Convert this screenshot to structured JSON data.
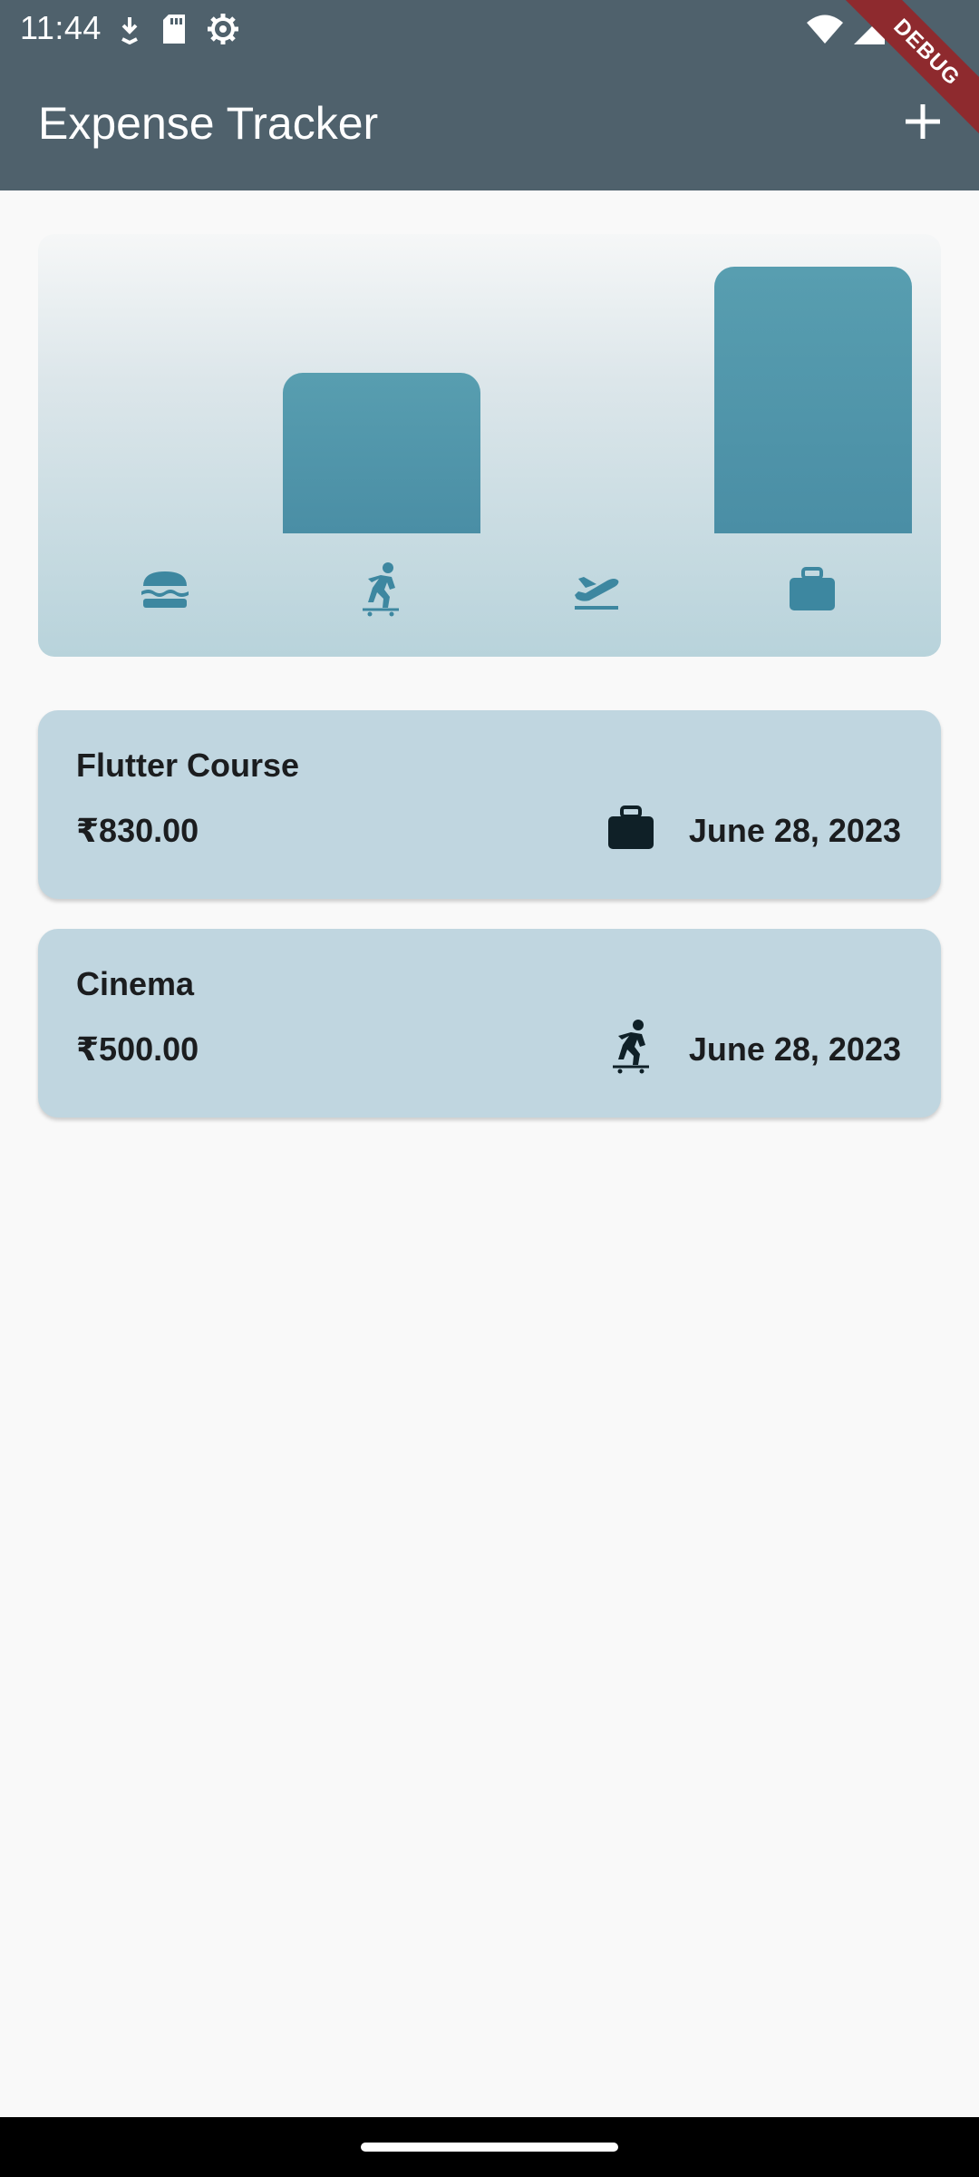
{
  "status_bar": {
    "time": "11:44",
    "left_icons": [
      "download-icon",
      "sd-card-icon",
      "settings-gear-icon"
    ],
    "right_icons": [
      "wifi-icon",
      "signal-icon",
      "battery-icon"
    ]
  },
  "app_bar": {
    "title": "Expense Tracker",
    "add_icon": "plus-icon",
    "debug_label": "DEBUG"
  },
  "chart_data": {
    "type": "bar",
    "categories": [
      "food",
      "leisure",
      "travel",
      "work"
    ],
    "category_icons": [
      "burger-icon",
      "skateboarding-icon",
      "flight-takeoff-icon",
      "work-briefcase-icon"
    ],
    "values": [
      0,
      500,
      0,
      830
    ],
    "ylim": [
      0,
      830
    ],
    "bar_color": "#4A8EA5"
  },
  "expenses": [
    {
      "title": "Flutter Course",
      "amount": "₹830.00",
      "category_icon": "work-briefcase-icon",
      "date": "June 28, 2023"
    },
    {
      "title": "Cinema",
      "amount": "₹500.00",
      "category_icon": "skateboarding-icon",
      "date": "June 28, 2023"
    }
  ],
  "colors": {
    "app_bar": "#4F616C",
    "card": "#C0D6E0",
    "accent": "#4A8EA5",
    "background": "#F9F9F9"
  }
}
